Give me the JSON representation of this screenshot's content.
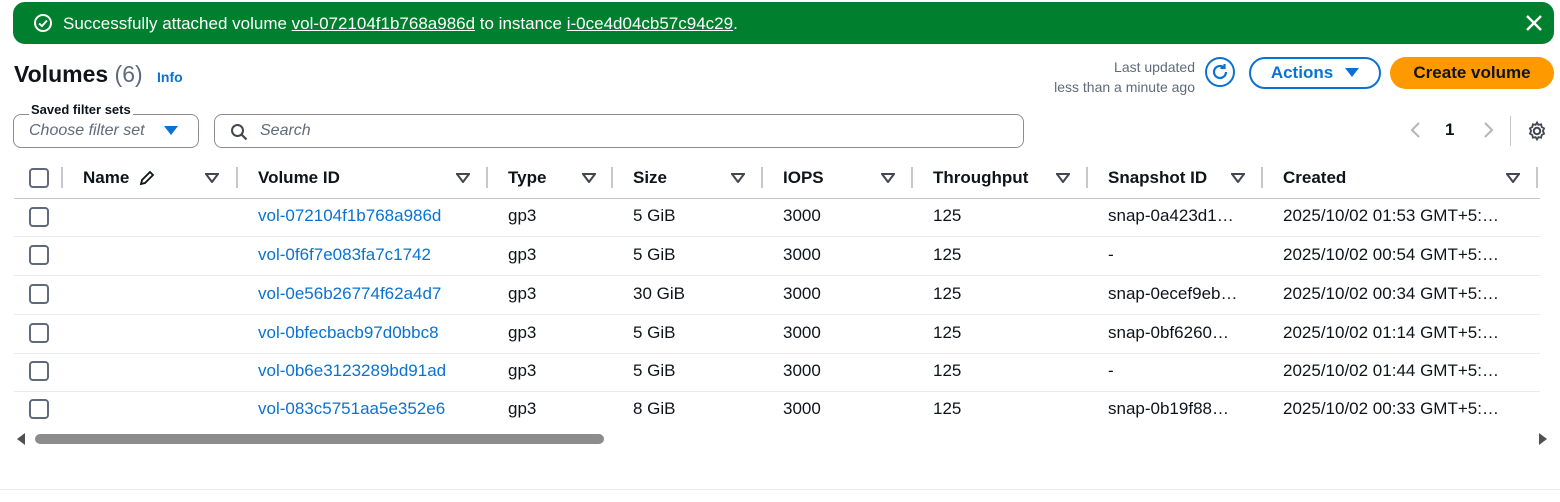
{
  "flash": {
    "prefix": "Successfully attached volume ",
    "volume_link": "vol-072104f1b768a986d",
    "middle": " to instance ",
    "instance_link": "i-0ce4d04cb57c94c29",
    "suffix": "."
  },
  "header": {
    "title": "Volumes",
    "count": "(6)",
    "info": "Info",
    "last_updated_line1": "Last updated",
    "last_updated_line2": "less than a minute ago",
    "actions_label": "Actions",
    "create_label": "Create volume"
  },
  "filters": {
    "saved_label": "Saved filter sets",
    "saved_placeholder": "Choose filter set",
    "search_placeholder": "Search"
  },
  "pagination": {
    "current_page": "1"
  },
  "table": {
    "columns": [
      "Name",
      "Volume ID",
      "Type",
      "Size",
      "IOPS",
      "Throughput",
      "Snapshot ID",
      "Created"
    ],
    "rows": [
      {
        "name": "",
        "volume_id": "vol-072104f1b768a986d",
        "type": "gp3",
        "size": "5 GiB",
        "iops": "3000",
        "throughput": "125",
        "snapshot": "snap-0a423d1…",
        "created": "2025/10/02 01:53 GMT+5:…"
      },
      {
        "name": "",
        "volume_id": "vol-0f6f7e083fa7c1742",
        "type": "gp3",
        "size": "5 GiB",
        "iops": "3000",
        "throughput": "125",
        "snapshot": "-",
        "created": "2025/10/02 00:54 GMT+5:…"
      },
      {
        "name": "",
        "volume_id": "vol-0e56b26774f62a4d7",
        "type": "gp3",
        "size": "30 GiB",
        "iops": "3000",
        "throughput": "125",
        "snapshot": "snap-0ecef9eb…",
        "created": "2025/10/02 00:34 GMT+5:…"
      },
      {
        "name": "",
        "volume_id": "vol-0bfecbacb97d0bbc8",
        "type": "gp3",
        "size": "5 GiB",
        "iops": "3000",
        "throughput": "125",
        "snapshot": "snap-0bf6260…",
        "created": "2025/10/02 01:14 GMT+5:…"
      },
      {
        "name": "",
        "volume_id": "vol-0b6e3123289bd91ad",
        "type": "gp3",
        "size": "5 GiB",
        "iops": "3000",
        "throughput": "125",
        "snapshot": "-",
        "created": "2025/10/02 01:44 GMT+5:…"
      },
      {
        "name": "",
        "volume_id": "vol-083c5751aa5e352e6",
        "type": "gp3",
        "size": "8 GiB",
        "iops": "3000",
        "throughput": "125",
        "snapshot": "snap-0b19f88…",
        "created": "2025/10/02 00:33 GMT+5:…"
      }
    ]
  },
  "colors": {
    "success": "#00802f",
    "link": "#0972d3",
    "primary_button": "#ff9900"
  },
  "icons": [
    "success-check-icon",
    "close-icon",
    "refresh-icon",
    "caret-down-icon",
    "search-icon",
    "chevron-left-icon",
    "chevron-right-icon",
    "settings-gear-icon",
    "edit-pencil-icon",
    "sort-caret-icon"
  ]
}
